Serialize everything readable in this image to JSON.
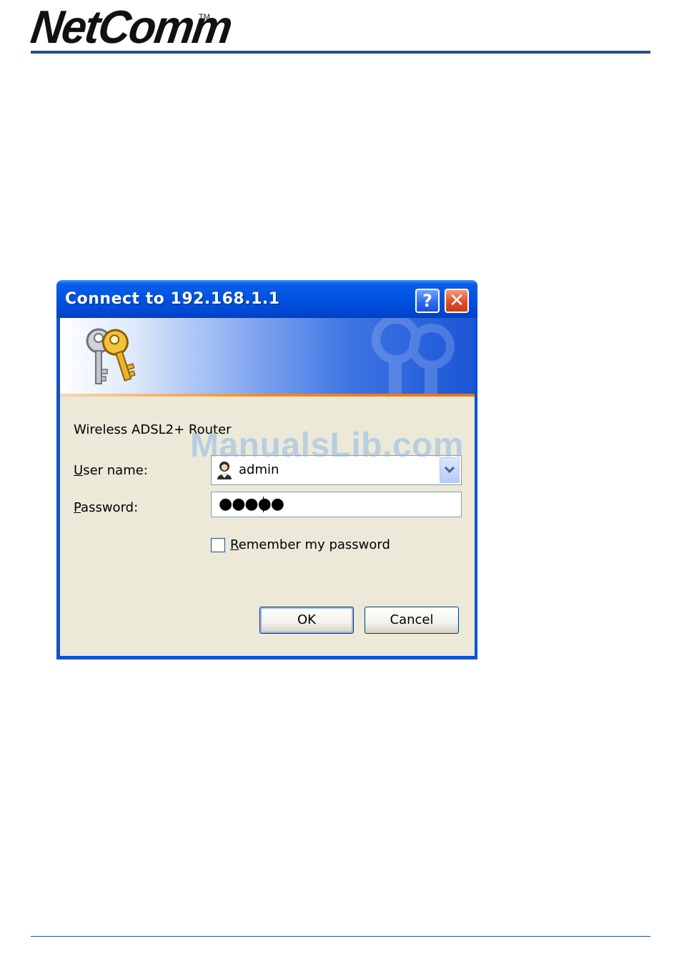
{
  "header": {
    "brand": "NetComm",
    "trademark": "TM"
  },
  "dialog": {
    "title": "Connect to 192.168.1.1",
    "help_label": "?",
    "close_label": "✕",
    "realm": "Wireless ADSL2+ Router",
    "user_label_accel": "U",
    "user_label_rest": "ser name:",
    "user_value": "admin",
    "password_label_accel": "P",
    "password_label_rest": "assword:",
    "password_value": "●●●●●",
    "remember_accel": "R",
    "remember_rest": "emember my password",
    "remember_checked": false,
    "ok_label": "OK",
    "cancel_label": "Cancel"
  },
  "watermark": "ManualsLib.com",
  "colors": {
    "header_rule": "#234f8a",
    "titlebar": "#0054e3",
    "dialog_body": "#ece9d8",
    "banner_stripe": "#f08a2b"
  },
  "icons": {
    "banner": "keys-icon",
    "user_field": "user-icon",
    "combo": "chevron-down-icon",
    "close": "close-icon",
    "help": "help-icon"
  }
}
